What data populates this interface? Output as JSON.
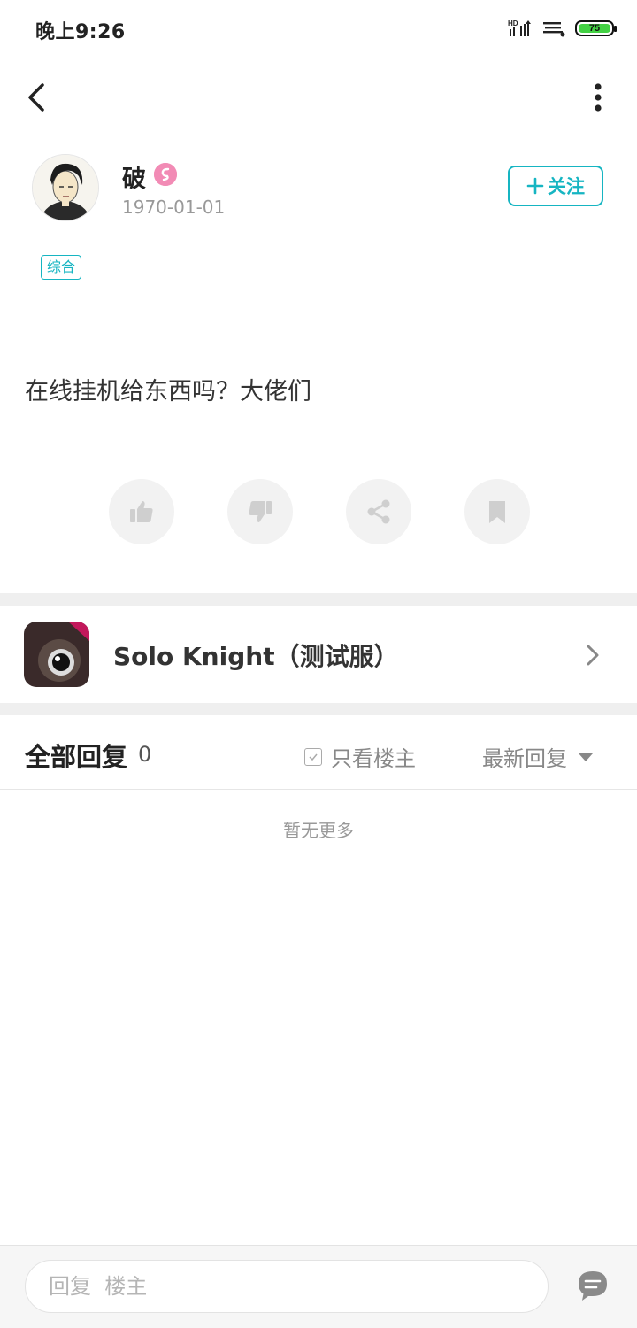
{
  "status_bar": {
    "time": "晚上9:26",
    "battery_level": "75",
    "icons": [
      "hd-signal-icon",
      "wifi-icon",
      "battery-icon"
    ]
  },
  "nav": {
    "back_icon": "chevron-left-icon",
    "more_icon": "more-vertical-icon"
  },
  "author": {
    "name": "破",
    "date": "1970-01-01",
    "level_badge_color": "#f28bb5"
  },
  "follow_button": {
    "label": "关注",
    "icon": "plus-icon"
  },
  "tag": "综合",
  "post": {
    "content": "在线挂机给东西吗？大佬们"
  },
  "actions": [
    {
      "name": "like",
      "icon": "thumbs-up-icon"
    },
    {
      "name": "dislike",
      "icon": "thumbs-down-icon"
    },
    {
      "name": "share",
      "icon": "share-icon"
    },
    {
      "name": "bookmark",
      "icon": "bookmark-icon"
    }
  ],
  "game": {
    "name": "Solo Knight（测试服）"
  },
  "replies": {
    "title": "全部回复",
    "count": "0",
    "only_op_label": "只看楼主",
    "sort_label": "最新回复",
    "empty_text": "暂无更多"
  },
  "reply_bar": {
    "placeholder": "回复  楼主"
  },
  "colors": {
    "accent": "#16b5c2",
    "divider": "#efefef"
  }
}
